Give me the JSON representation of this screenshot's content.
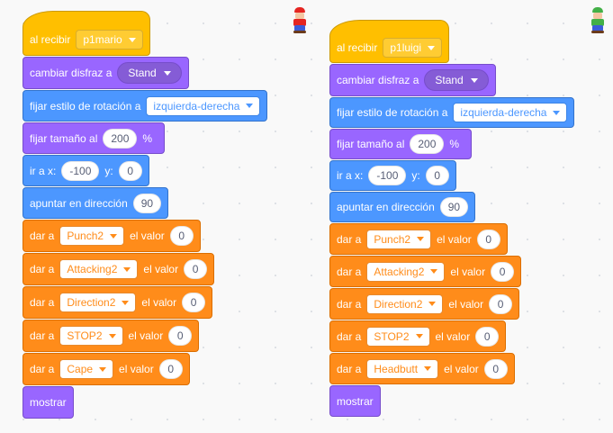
{
  "scripts": [
    {
      "sprite_icon": "mario-sprite-icon",
      "blocks": [
        {
          "type": "hat",
          "category": "events",
          "label": "al recibir",
          "dropdown": "p1mario"
        },
        {
          "type": "looks",
          "label": "cambiar disfraz a",
          "pill": "Stand"
        },
        {
          "type": "motion",
          "label": "fijar estilo de rotación a",
          "dropdown": "izquierda-derecha"
        },
        {
          "type": "looks",
          "label": "fijar tamaño al",
          "value": "200",
          "suffix": "%"
        },
        {
          "type": "motion",
          "label": "ir a x:",
          "x": "-100",
          "ylabel": "y:",
          "y": "0"
        },
        {
          "type": "motion",
          "label": "apuntar en dirección",
          "value": "90"
        },
        {
          "type": "vars",
          "label": "dar a",
          "var": "Punch2",
          "mid": "el valor",
          "value": "0"
        },
        {
          "type": "vars",
          "label": "dar a",
          "var": "Attacking2",
          "mid": "el valor",
          "value": "0"
        },
        {
          "type": "vars",
          "label": "dar a",
          "var": "Direction2",
          "mid": "el valor",
          "value": "0"
        },
        {
          "type": "vars",
          "label": "dar a",
          "var": "STOP2",
          "mid": "el valor",
          "value": "0"
        },
        {
          "type": "vars",
          "label": "dar a",
          "var": "Cape",
          "mid": "el valor",
          "value": "0"
        },
        {
          "type": "looks",
          "label": "mostrar"
        }
      ]
    },
    {
      "sprite_icon": "luigi-sprite-icon",
      "blocks": [
        {
          "type": "hat",
          "category": "events",
          "label": "al recibir",
          "dropdown": "p1luigi"
        },
        {
          "type": "looks",
          "label": "cambiar disfraz a",
          "pill": "Stand"
        },
        {
          "type": "motion",
          "label": "fijar estilo de rotación a",
          "dropdown": "izquierda-derecha"
        },
        {
          "type": "looks",
          "label": "fijar tamaño al",
          "value": "200",
          "suffix": "%"
        },
        {
          "type": "motion",
          "label": "ir a x:",
          "x": "-100",
          "ylabel": "y:",
          "y": "0"
        },
        {
          "type": "motion",
          "label": "apuntar en dirección",
          "value": "90"
        },
        {
          "type": "vars",
          "label": "dar a",
          "var": "Punch2",
          "mid": "el valor",
          "value": "0"
        },
        {
          "type": "vars",
          "label": "dar a",
          "var": "Attacking2",
          "mid": "el valor",
          "value": "0"
        },
        {
          "type": "vars",
          "label": "dar a",
          "var": "Direction2",
          "mid": "el valor",
          "value": "0"
        },
        {
          "type": "vars",
          "label": "dar a",
          "var": "STOP2",
          "mid": "el valor",
          "value": "0"
        },
        {
          "type": "vars",
          "label": "dar a",
          "var": "Headbutt",
          "mid": "el valor",
          "value": "0"
        },
        {
          "type": "looks",
          "label": "mostrar"
        }
      ]
    }
  ],
  "colors": {
    "events": "#ffbf00",
    "looks": "#9966ff",
    "motion": "#4c97ff",
    "variables": "#ff8c1a",
    "mario_hat": "#e52521",
    "luigi_hat": "#43b047"
  }
}
